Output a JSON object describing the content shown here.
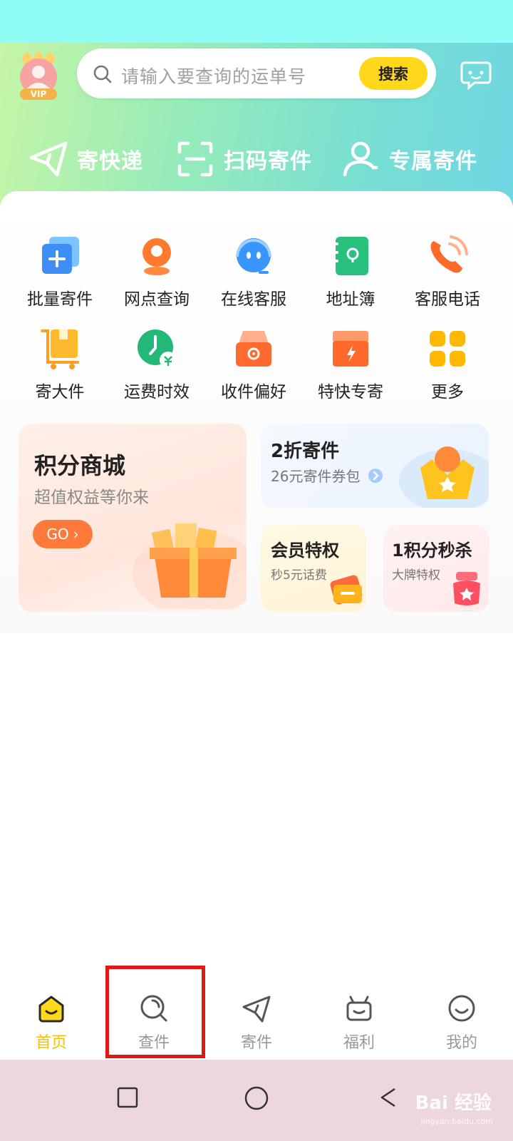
{
  "header": {
    "vip_badge_text": "VIP",
    "search": {
      "placeholder": "请输入要查询的运单号",
      "button_label": "搜索"
    },
    "quick_actions": [
      {
        "label": "寄快递",
        "icon": "paper-plane-icon"
      },
      {
        "label": "扫码寄件",
        "icon": "scan-icon"
      },
      {
        "label": "专属寄件",
        "icon": "user-icon"
      }
    ]
  },
  "services": [
    {
      "label": "批量寄件",
      "icon": "batch-send-icon"
    },
    {
      "label": "网点查询",
      "icon": "location-icon"
    },
    {
      "label": "在线客服",
      "icon": "chat-robot-icon"
    },
    {
      "label": "地址簿",
      "icon": "address-book-icon"
    },
    {
      "label": "客服电话",
      "icon": "phone-icon"
    },
    {
      "label": "寄大件",
      "icon": "big-package-icon"
    },
    {
      "label": "运费时效",
      "icon": "clock-fee-icon"
    },
    {
      "label": "收件偏好",
      "icon": "inbox-icon"
    },
    {
      "label": "特快专寄",
      "icon": "express-box-icon"
    },
    {
      "label": "更多",
      "icon": "more-grid-icon"
    }
  ],
  "promos": {
    "points_mall": {
      "title": "积分商城",
      "subtitle": "超值权益等你来",
      "button": "GO"
    },
    "discount": {
      "title": "2折寄件",
      "subtitle": "26元寄件券包"
    },
    "member": {
      "title": "会员特权",
      "subtitle": "秒5元话费"
    },
    "flash": {
      "title": "1积分秒杀",
      "subtitle": "大牌特权"
    }
  },
  "tabbar": [
    {
      "label": "首页",
      "icon": "home-icon",
      "active": true
    },
    {
      "label": "查件",
      "icon": "search-parcel-icon",
      "active": false
    },
    {
      "label": "寄件",
      "icon": "send-plane-icon",
      "active": false
    },
    {
      "label": "福利",
      "icon": "gift-icon",
      "active": false
    },
    {
      "label": "我的",
      "icon": "smile-icon",
      "active": false
    }
  ],
  "watermark": {
    "text": "Bai 经验",
    "url": "jingyan.baidu.com"
  },
  "colors": {
    "accent": "#ffd81c",
    "active_tab": "#f2c200",
    "highlight": "#e01818"
  }
}
